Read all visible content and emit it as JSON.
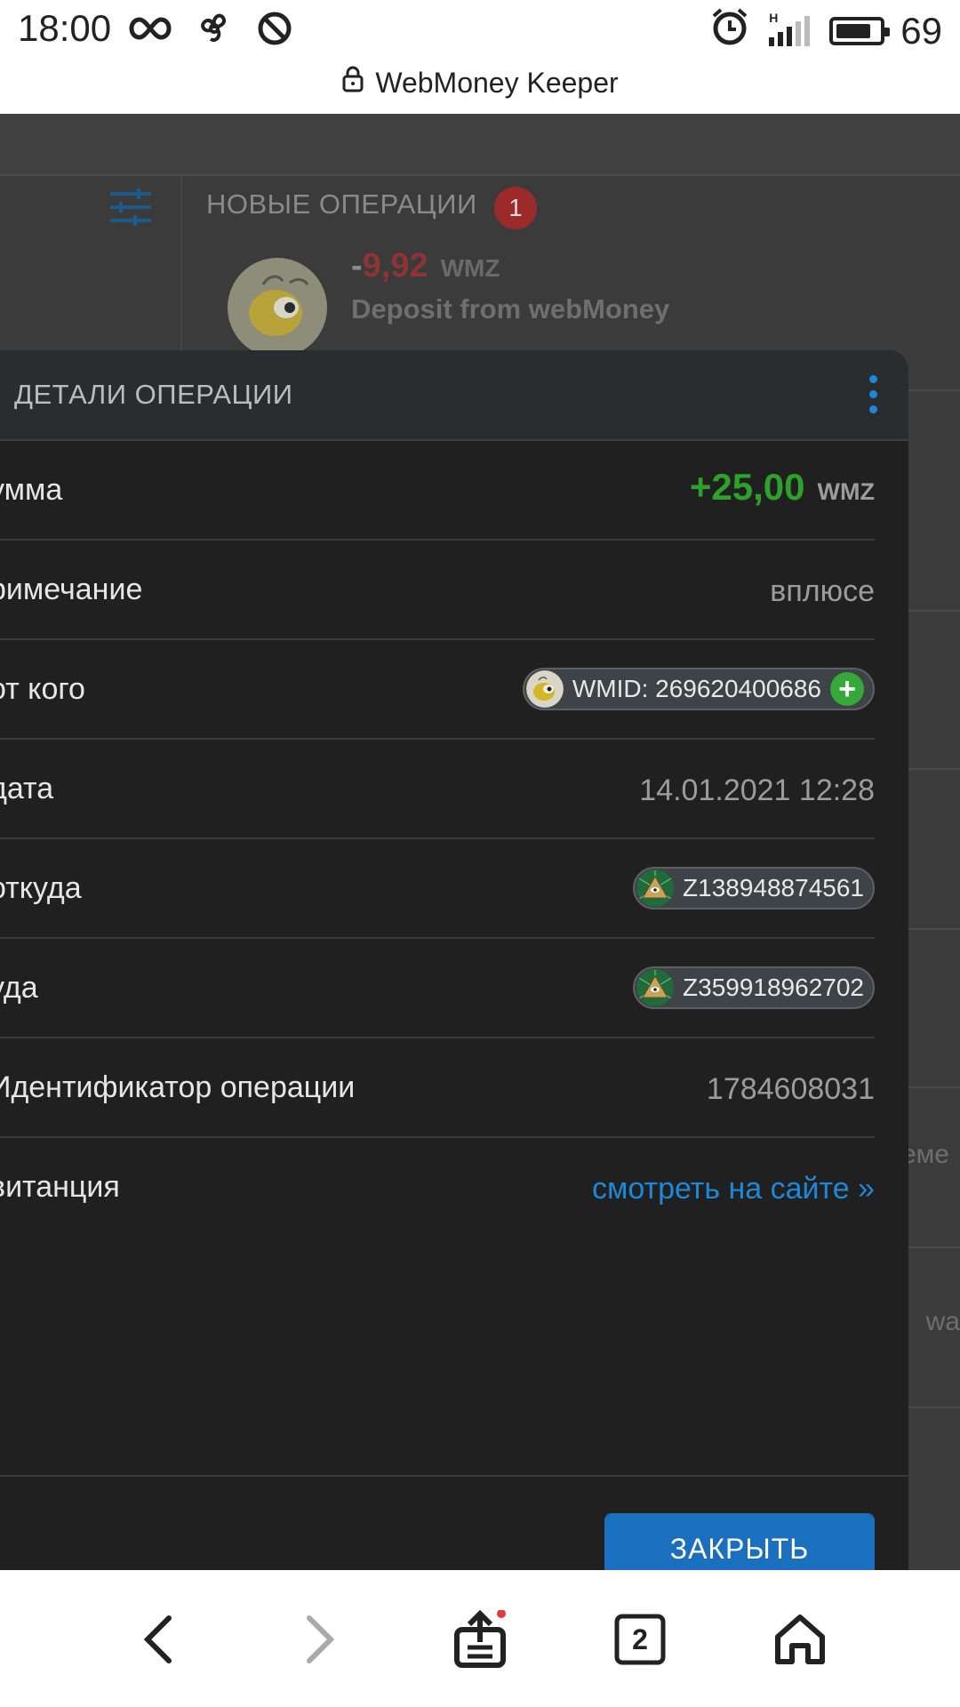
{
  "status_bar": {
    "time": "18:00",
    "battery": "69",
    "network": "H",
    "icons_left": [
      "infinity-icon",
      "fan-icon",
      "do-not-disturb-icon"
    ],
    "icons_right": [
      "alarm-icon",
      "signal-icon",
      "battery-icon"
    ]
  },
  "browser": {
    "url_title": "WebMoney Keeper",
    "tabs_count": "2",
    "nav_icons": [
      "back-icon",
      "forward-icon",
      "share-icon",
      "tabs-icon",
      "home-icon"
    ]
  },
  "background_page": {
    "new_ops_title": "НОВЫЕ ОПЕРАЦИИ",
    "new_ops_badge": "1",
    "last_op_sign": "-",
    "last_op_amount": "9,92",
    "last_op_currency": "WMZ",
    "last_op_description": "Deposit from webMoney",
    "partial_text_1": "еме",
    "partial_text_2": "wa"
  },
  "modal": {
    "title": "ДЕТАЛИ ОПЕРАЦИИ",
    "rows": {
      "amount": {
        "label": "умма",
        "value": "+25,00",
        "currency": "WMZ"
      },
      "note": {
        "label": "римечание",
        "value": "вплюсе"
      },
      "from_whom": {
        "label": "от кого",
        "value": "WMID: 269620400686"
      },
      "date": {
        "label": "дата",
        "value": "14.01.2021 12:28"
      },
      "from_purse": {
        "label": "откуда",
        "value": "Z138948874561"
      },
      "to_purse": {
        "label": "уда",
        "value": "Z359918962702"
      },
      "operation_id": {
        "label": "Идентификатор операции",
        "value": "1784608031"
      },
      "receipt": {
        "label": "витанция",
        "value": "смотреть на сайте »"
      }
    },
    "close_label": "ЗАКРЫТЬ"
  },
  "colors": {
    "accent_blue": "#1e88d8",
    "positive_green": "#2ea12a",
    "negative_red": "#8f3434",
    "button_blue": "#1a6fbe"
  }
}
